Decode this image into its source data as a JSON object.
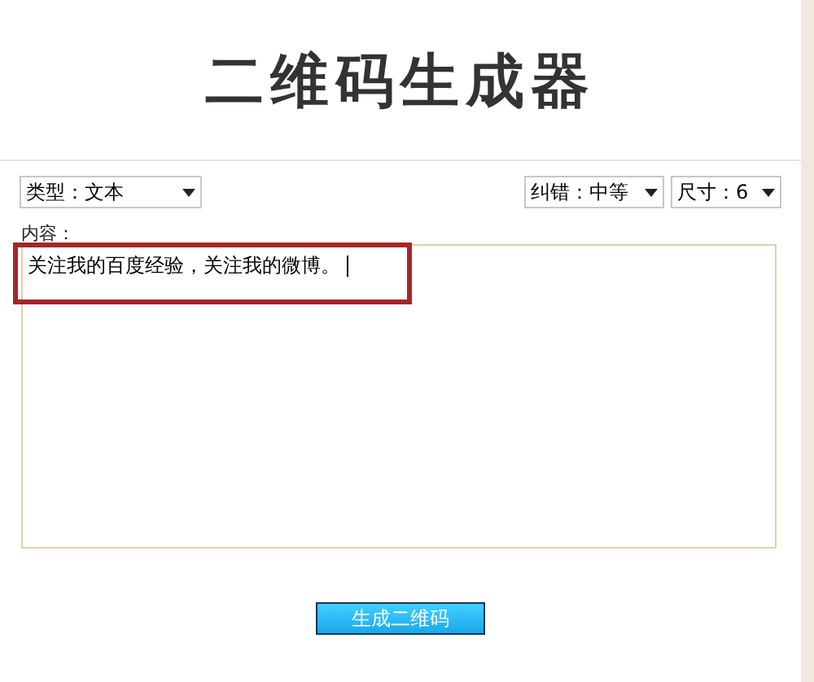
{
  "title": "二维码生成器",
  "selects": [
    {
      "kind": "type",
      "value": "类型：文本"
    },
    {
      "kind": "level",
      "value": "纠错：中等"
    },
    {
      "kind": "size",
      "value": "尺寸：6"
    }
  ],
  "content": {
    "label": "内容：",
    "value": "关注我的百度经验，关注我的微博。",
    "highlighted": true
  },
  "button": "生成二维码"
}
